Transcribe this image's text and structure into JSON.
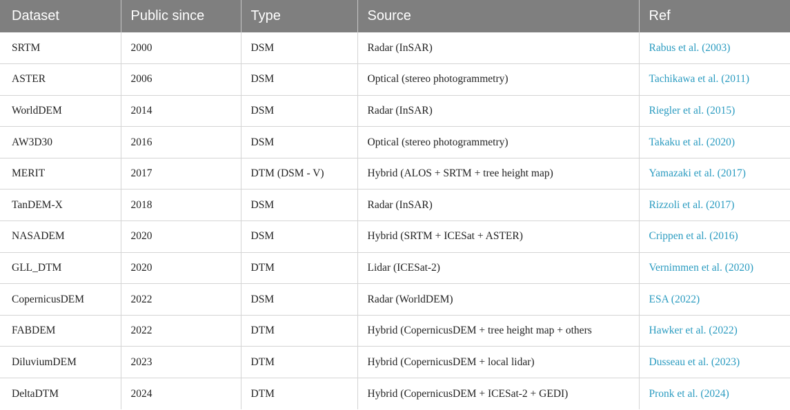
{
  "table": {
    "headers": [
      "Dataset",
      "Public since",
      "Type",
      "Source",
      "Ref"
    ],
    "rows": [
      {
        "dataset": "SRTM",
        "year": "2000",
        "type": "DSM",
        "source": "Radar (InSAR)",
        "ref": "Rabus et al. (2003)"
      },
      {
        "dataset": "ASTER",
        "year": "2006",
        "type": "DSM",
        "source": "Optical (stereo photogrammetry)",
        "ref": "Tachikawa et al. (2011)"
      },
      {
        "dataset": "WorldDEM",
        "year": "2014",
        "type": "DSM",
        "source": "Radar (InSAR)",
        "ref": "Riegler et al. (2015)"
      },
      {
        "dataset": "AW3D30",
        "year": "2016",
        "type": "DSM",
        "source": "Optical (stereo photogrammetry)",
        "ref": "Takaku et al. (2020)"
      },
      {
        "dataset": "MERIT",
        "year": "2017",
        "type": "DTM (DSM - V)",
        "source": "Hybrid (ALOS + SRTM + tree height map)",
        "ref": "Yamazaki et al. (2017)"
      },
      {
        "dataset": "TanDEM-X",
        "year": "2018",
        "type": "DSM",
        "source": "Radar (InSAR)",
        "ref": "Rizzoli et al. (2017)"
      },
      {
        "dataset": "NASADEM",
        "year": "2020",
        "type": "DSM",
        "source": "Hybrid (SRTM + ICESat + ASTER)",
        "ref": "Crippen et al. (2016)"
      },
      {
        "dataset": "GLL_DTM",
        "year": "2020",
        "type": "DTM",
        "source": "Lidar (ICESat-2)",
        "ref": "Vernimmen et al. (2020)"
      },
      {
        "dataset": "CopernicusDEM",
        "year": "2022",
        "type": "DSM",
        "source": "Radar (WorldDEM)",
        "ref": "ESA (2022)"
      },
      {
        "dataset": "FABDEM",
        "year": "2022",
        "type": "DTM",
        "source": "Hybrid (CopernicusDEM + tree height map + others",
        "ref": "Hawker et al. (2022)"
      },
      {
        "dataset": "DiluviumDEM",
        "year": "2023",
        "type": "DTM",
        "source": "Hybrid (CopernicusDEM + local lidar)",
        "ref": "Dusseau et al. (2023)"
      },
      {
        "dataset": "DeltaDTM",
        "year": "2024",
        "type": "DTM",
        "source": "Hybrid (CopernicusDEM + ICESat-2 + GEDI)",
        "ref": "Pronk et al. (2024)"
      }
    ]
  },
  "colors": {
    "header_bg": "#7f7f7f",
    "header_text": "#ffffff",
    "link": "#2a9bc0",
    "grid": "#d4d4d4"
  }
}
